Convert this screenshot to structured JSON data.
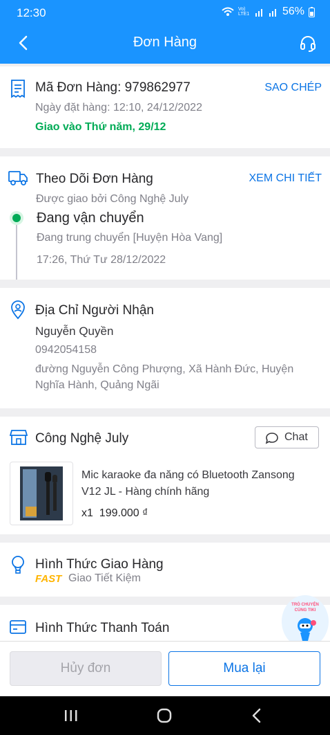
{
  "status": {
    "time": "12:30",
    "battery": "56%",
    "network": "Vo) LTE1"
  },
  "header": {
    "title": "Đơn Hàng"
  },
  "order": {
    "code_label": "Mã Đơn Hàng: 979862977",
    "copy": "SAO CHÉP",
    "date": "Ngày đặt hàng: 12:10, 24/12/2022",
    "delivery": "Giao vào Thứ năm, 29/12"
  },
  "tracking": {
    "title": "Theo Dõi Đơn Hàng",
    "detail": "XEM CHI TIẾT",
    "shipper": "Được giao bởi Công Nghệ July",
    "status": "Đang vận chuyển",
    "location": "Đang trung chuyển [Huyện Hòa Vang]",
    "time": "17:26, Thứ Tư 28/12/2022"
  },
  "address": {
    "title": "Địa Chỉ Người Nhận",
    "name": "Nguyễn Quyền",
    "phone": "0942054158",
    "line1": "đường Nguyễn Công Phượng, Xã Hành Đức, Huyện",
    "line2": "Nghĩa Hành, Quảng Ngãi"
  },
  "seller": {
    "name": "Công Nghệ July",
    "chat": "Chat"
  },
  "product": {
    "title_line1": "Mic karaoke đa năng có Bluetooth Zansong",
    "title_line2": "V12 JL - Hàng chính hãng",
    "qty": "x1",
    "price": "199.000 ₫"
  },
  "shipping": {
    "title": "Hình Thức Giao Hàng",
    "badge": "FAST",
    "method": "Giao Tiết Kiệm"
  },
  "payment": {
    "title": "Hình Thức Thanh Toán"
  },
  "chat_bubble": {
    "line1": "TRÒ CHUYỆN",
    "line2": "CÙNG TIKI"
  },
  "actions": {
    "cancel": "Hủy đơn",
    "rebuy": "Mua lại"
  },
  "colors": {
    "primary": "#1a94ff",
    "green": "#00ab56",
    "link": "#0b74e5",
    "fast": "#ffb400"
  }
}
